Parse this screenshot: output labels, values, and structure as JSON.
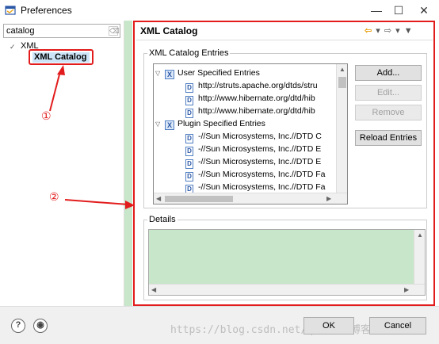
{
  "window": {
    "title": "Preferences",
    "min_glyph": "—",
    "max_glyph": "☐",
    "close_glyph": "✕"
  },
  "sidebar": {
    "filter_value": "catalog",
    "tree": [
      {
        "label": "XML",
        "expanded": true
      },
      {
        "label": "XML Catalog",
        "selected": true
      }
    ]
  },
  "annotations": {
    "one": "①",
    "two": "②",
    "color": "#e21c1c"
  },
  "page": {
    "title": "XML Catalog",
    "entries_group_label": "XML Catalog Entries",
    "entries": [
      {
        "label": "User Specified Entries",
        "type": "group"
      },
      {
        "label": "http://struts.apache.org/dtds/stru",
        "type": "item"
      },
      {
        "label": "http://www.hibernate.org/dtd/hib",
        "type": "item"
      },
      {
        "label": "http://www.hibernate.org/dtd/hib",
        "type": "item"
      },
      {
        "label": "Plugin Specified Entries",
        "type": "group"
      },
      {
        "label": "-//Sun Microsystems, Inc.//DTD C",
        "type": "item"
      },
      {
        "label": "-//Sun Microsystems, Inc.//DTD E",
        "type": "item"
      },
      {
        "label": "-//Sun Microsystems, Inc.//DTD E",
        "type": "item"
      },
      {
        "label": "-//Sun Microsystems, Inc.//DTD Fa",
        "type": "item"
      },
      {
        "label": "-//Sun Microsystems, Inc.//DTD Fa",
        "type": "item"
      }
    ],
    "buttons": {
      "add": "Add...",
      "edit": "Edit...",
      "remove": "Remove",
      "reload": "Reload Entries"
    },
    "details_label": "Details"
  },
  "footer": {
    "help_glyph": "?",
    "ok": "OK",
    "cancel": "Cancel",
    "watermark": "https://blog.csdn.net/q@51CTO博客"
  },
  "colors": {
    "selection_bg": "#cce4f7",
    "details_bg": "#c8e6c9",
    "accent_red": "#e21c1c"
  }
}
